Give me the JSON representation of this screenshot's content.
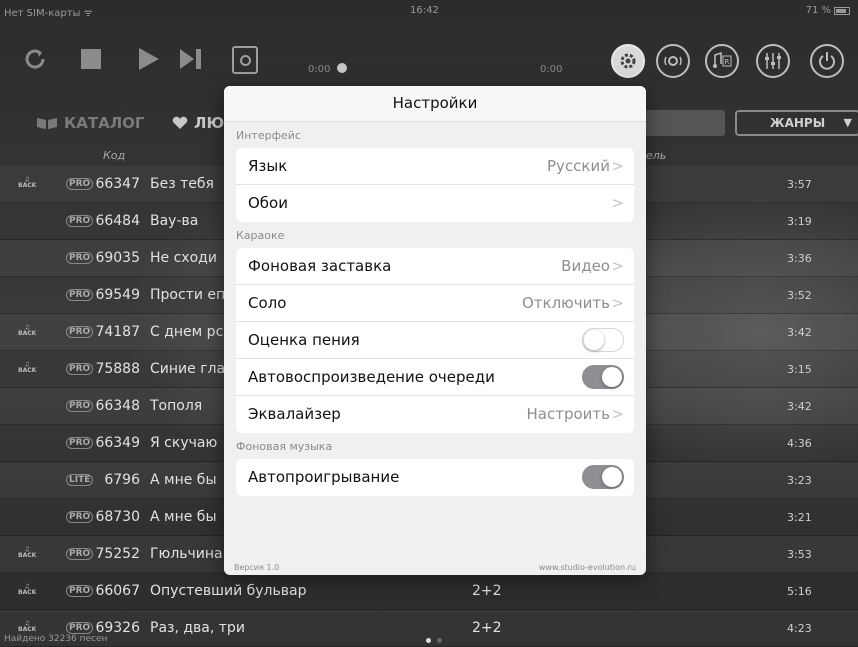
{
  "status": {
    "carrier": "Нет SIM-карты ᯤ",
    "time": "16:42",
    "battery": "71 %"
  },
  "player": {
    "elapsed": "0:00",
    "remaining": "0:00"
  },
  "nav": {
    "catalog": "КАТАЛОГ",
    "favorites": "ЛЮ",
    "genres": "ЖАНРЫ"
  },
  "columns": {
    "code": "Код",
    "performer": "ель"
  },
  "songs": [
    {
      "back": true,
      "tag": "PRO",
      "code": "66347",
      "title": "Без тебя",
      "artist": "",
      "duration": "3:57"
    },
    {
      "back": false,
      "tag": "PRO",
      "code": "66484",
      "title": "Вау-ва",
      "artist": "",
      "duration": "3:19"
    },
    {
      "back": false,
      "tag": "PRO",
      "code": "69035",
      "title": "Не сходи",
      "artist": "",
      "duration": "3:36"
    },
    {
      "back": false,
      "tag": "PRO",
      "code": "69549",
      "title": "Прости еп",
      "artist": "",
      "duration": "3:52"
    },
    {
      "back": true,
      "tag": "PRO",
      "code": "74187",
      "title": "С днем рс",
      "artist": "",
      "duration": "3:42"
    },
    {
      "back": true,
      "tag": "PRO",
      "code": "75888",
      "title": "Синие гла",
      "artist": "",
      "duration": "3:15"
    },
    {
      "back": false,
      "tag": "PRO",
      "code": "66348",
      "title": "Тополя",
      "artist": "",
      "duration": "3:42"
    },
    {
      "back": false,
      "tag": "PRO",
      "code": "66349",
      "title": "Я скучаю",
      "artist": "",
      "duration": "4:36"
    },
    {
      "back": false,
      "tag": "LITE",
      "code": "6796",
      "title": "А мне бы",
      "artist": "",
      "duration": "3:23"
    },
    {
      "back": false,
      "tag": "PRO",
      "code": "68730",
      "title": "А мне бы",
      "artist": "",
      "duration": "3:21"
    },
    {
      "back": true,
      "tag": "PRO",
      "code": "75252",
      "title": "Гюльчина",
      "artist": "",
      "duration": "3:53"
    },
    {
      "back": true,
      "tag": "PRO",
      "code": "66067",
      "title": "Опустевший бульвар",
      "artist": "2+2",
      "duration": "5:16"
    },
    {
      "back": true,
      "tag": "PRO",
      "code": "69326",
      "title": "Раз, два, три",
      "artist": "2+2",
      "duration": "4:23"
    }
  ],
  "footer": {
    "found": "Найдено 32236 песен"
  },
  "settings": {
    "title": "Настройки",
    "interface_head": "Интерфейс",
    "language_label": "Язык",
    "language_value": "Русский",
    "wallpaper_label": "Обои",
    "karaoke_head": "Караоке",
    "background_label": "Фоновая заставка",
    "background_value": "Видео",
    "solo_label": "Соло",
    "solo_value": "Отключить",
    "scoring_label": "Оценка пения",
    "autoplay_queue_label": "Автовоспроизведение очереди",
    "equalizer_label": "Эквалайзер",
    "equalizer_value": "Настроить",
    "music_head": "Фоновая музыка",
    "autoplay_label": "Автопроигрывание",
    "version": "Версия 1.0",
    "site": "www.studio-evolution.ru"
  }
}
